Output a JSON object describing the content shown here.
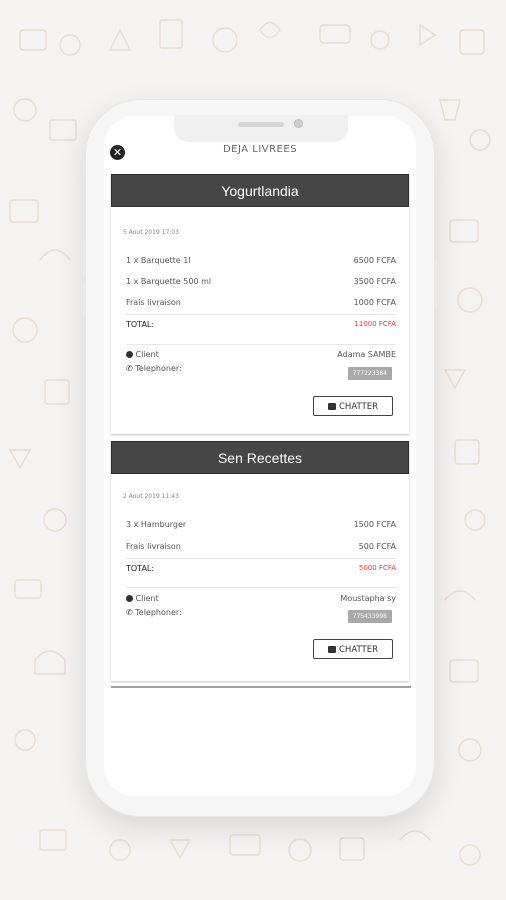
{
  "header": {
    "title": "DEJA LIVREES",
    "close_icon": "close-icon"
  },
  "orders": [
    {
      "restaurant": "Yogurtlandia",
      "date": "5 Aout 2019 17:03",
      "items": [
        {
          "label": "1 x Barquette 1l",
          "price": "6500 FCFA"
        },
        {
          "label": "1 x Barquette 500 ml",
          "price": "3500 FCFA"
        },
        {
          "label": "Frais livraison",
          "price": "1000 FCFA"
        }
      ],
      "total_label": "TOTAL:",
      "total_value": "11000 FCFA",
      "client_label": "Client",
      "client_name": "Adama SAMBE",
      "phone_label": "Telephoner:",
      "phone_number": "777223384",
      "chat_label": "CHATTER"
    },
    {
      "restaurant": "Sen Recettes",
      "date": "2 Aout 2019 11:43",
      "items": [
        {
          "label": "3 x Hamburger",
          "price": "1500 FCFA"
        },
        {
          "label": "Frais livraison",
          "price": "500 FCFA"
        }
      ],
      "total_label": "TOTAL:",
      "total_value": "5000 FCFA",
      "client_label": "Client",
      "client_name": "Moustapha sy",
      "phone_label": "Telephoner:",
      "phone_number": "775433998",
      "chat_label": "CHATTER"
    }
  ],
  "colors": {
    "card_header": "#464646",
    "total": "#e53935",
    "chip": "#a9a9a9"
  }
}
